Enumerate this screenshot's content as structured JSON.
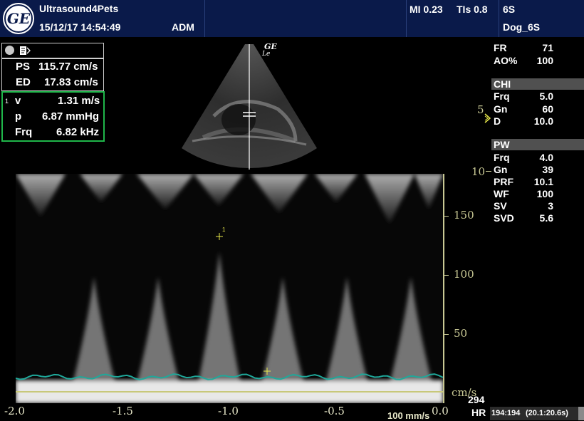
{
  "header": {
    "site": "Ultrasound4Pets",
    "datetime": "15/12/17 14:54:49",
    "operator": "ADM",
    "mi": "MI 0.23",
    "tis": "TIs 0.8",
    "probe": "6S",
    "preset": "Dog_6S",
    "logo_text": "GE"
  },
  "measure": {
    "ps_label": "PS",
    "ps_value": "115.77 cm/s",
    "ed_label": "ED",
    "ed_value": "17.83 cm/s",
    "marker": "1",
    "v_label": "v",
    "v_value": "1.31 m/s",
    "p_label": "p",
    "p_value": "6.87 mmHg",
    "frq_label": "Frq",
    "frq_value": "6.82 kHz"
  },
  "sector": {
    "logo": "GE",
    "orientation": "Le"
  },
  "params": {
    "fr_label": "FR",
    "fr_value": "71",
    "ao_label": "AO%",
    "ao_value": "100",
    "chi_title": "CHI",
    "chi_frq_label": "Frq",
    "chi_frq_value": "5.0",
    "chi_gn_label": "Gn",
    "chi_gn_value": "60",
    "chi_d_label": "D",
    "chi_d_value": "10.0",
    "pw_title": "PW",
    "pw_frq_label": "Frq",
    "pw_frq_value": "4.0",
    "pw_gn_label": "Gn",
    "pw_gn_value": "39",
    "pw_prf_label": "PRF",
    "pw_prf_value": "10.1",
    "pw_wf_label": "WF",
    "pw_wf_value": "100",
    "pw_sv_label": "SV",
    "pw_sv_value": "3",
    "pw_svd_label": "SVD",
    "pw_svd_value": "5.6"
  },
  "depth": {
    "d5": "5",
    "d10": "10"
  },
  "spectrum": {
    "y_ticks": [
      "150",
      "100",
      "50"
    ],
    "unit": "cm/s",
    "x_ticks": [
      "-2.0",
      "-1.5",
      "-1.0",
      "-0.5",
      "0.0"
    ],
    "sweep": "100 mm/s",
    "hr_value": "294",
    "hr_label": "HR",
    "frame": "194:194",
    "time": "(20.1:20.6s)",
    "cursor_label": "1",
    "colors": {
      "baseline": "#c8c87a",
      "trace": "#1fa89a",
      "caliper": "#e8e84a"
    }
  }
}
